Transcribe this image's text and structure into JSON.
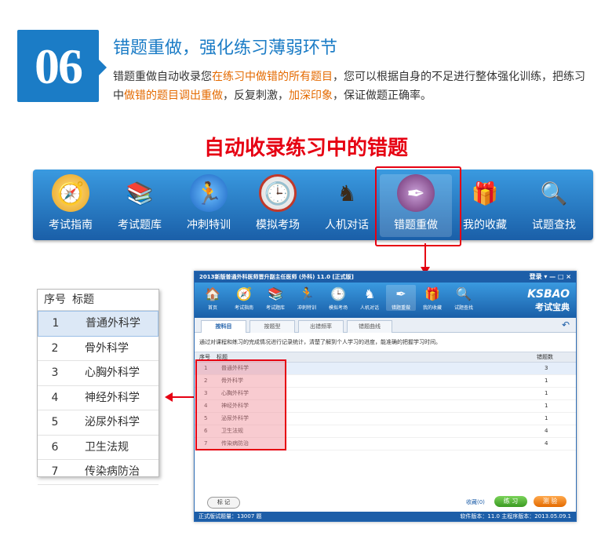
{
  "badge": {
    "number": "06"
  },
  "heading": "错题重做，强化练习薄弱环节",
  "description": {
    "p1": "错题重做自动收录您",
    "h1": "在练习中做错的所有题目",
    "p2": "，您可以根据自身的不足进行整体强化训练，把练习中",
    "h2": "做错的题目调出重做",
    "p3": "，反复刺激，",
    "h3": "加深印象",
    "p4": "，保证做题正确率。"
  },
  "section_title": "自动收录练习中的错题",
  "nav": [
    {
      "label": "考试指南",
      "icon": "compass-icon"
    },
    {
      "label": "考试题库",
      "icon": "books-icon"
    },
    {
      "label": "冲刺特训",
      "icon": "runner-icon"
    },
    {
      "label": "模拟考场",
      "icon": "clock-icon"
    },
    {
      "label": "人机对话",
      "icon": "chess-knight-icon"
    },
    {
      "label": "错题重做",
      "icon": "pen-ink-icon"
    },
    {
      "label": "我的收藏",
      "icon": "gift-box-icon"
    },
    {
      "label": "试题查找",
      "icon": "magnifier-icon"
    }
  ],
  "list": {
    "header": {
      "col1": "序号",
      "col2": "标题"
    },
    "rows": [
      {
        "no": "1",
        "title": "普通外科学"
      },
      {
        "no": "2",
        "title": "骨外科学"
      },
      {
        "no": "3",
        "title": "心胸外科学"
      },
      {
        "no": "4",
        "title": "神经外科学"
      },
      {
        "no": "5",
        "title": "泌尿外科学"
      },
      {
        "no": "6",
        "title": "卫生法规"
      },
      {
        "no": "7",
        "title": "传染病防治"
      }
    ]
  },
  "app": {
    "title": "2013新版普通外科医师晋升副主任医师 (外科) 11.0 [正式版]",
    "controls": "登录 ▾ — □ ×",
    "nav": [
      "首页",
      "考试指南",
      "考试题库",
      "冲刺特训",
      "模拟考场",
      "人机对话",
      "错题重做",
      "我的收藏",
      "试题查找"
    ],
    "brand1": "KSBAO",
    "brand2": "考试宝典",
    "tabs": [
      "按科目",
      "按题型",
      "出错频率",
      "错题曲线"
    ],
    "info": "通过对课程和练习的完成情况进行记录统计，清楚了解到个人学习的进度，能准确的把握学习时间。",
    "table": {
      "headers": {
        "no": "序号",
        "title": "标题",
        "count": "错题数"
      },
      "rows": [
        {
          "no": "1",
          "title": "普通外科学",
          "count": "3"
        },
        {
          "no": "2",
          "title": "骨外科学",
          "count": "1"
        },
        {
          "no": "3",
          "title": "心胸外科学",
          "count": "1"
        },
        {
          "no": "4",
          "title": "神经外科学",
          "count": "1"
        },
        {
          "no": "5",
          "title": "泌尿外科学",
          "count": "1"
        },
        {
          "no": "6",
          "title": "卫生法规",
          "count": "4"
        },
        {
          "no": "7",
          "title": "传染病防治",
          "count": "4"
        }
      ]
    },
    "buttons": {
      "mark": "标 记",
      "collect": "收藏(0)",
      "practice": "练 习",
      "test": "测 验"
    },
    "status_left": "正式版试题量：13007 题",
    "status_right": "软件版本：11.0  主程序版本：2013.05.09.1"
  },
  "colors": {
    "brand_blue": "#1b7cc6",
    "highlight_orange": "#e46a00",
    "accent_red": "#e60012"
  }
}
